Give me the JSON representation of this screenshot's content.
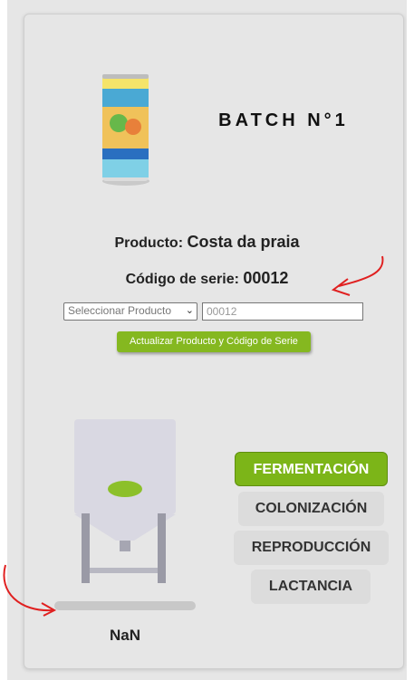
{
  "batch": {
    "title": "BATCH N°1"
  },
  "product": {
    "label": "Producto:",
    "name": "Costa da praia",
    "serial_label": "Código de serie:",
    "serial": "00012"
  },
  "form": {
    "select_value": "Seleccionar Producto",
    "serial_input_value": "00012",
    "update_button": "Actualizar Producto y Código de Serie"
  },
  "stages": [
    {
      "label": "FERMENTACIÓN",
      "active": true
    },
    {
      "label": "COLONIZACIÓN",
      "active": false
    },
    {
      "label": "REPRODUCCIÓN",
      "active": false
    },
    {
      "label": "LACTANCIA",
      "active": false
    }
  ],
  "tank": {
    "reading": "NaN",
    "progress_percent": 0
  },
  "colors": {
    "accent_green": "#7cb518",
    "button_green": "#85b820",
    "annotation_red": "#e02020"
  }
}
